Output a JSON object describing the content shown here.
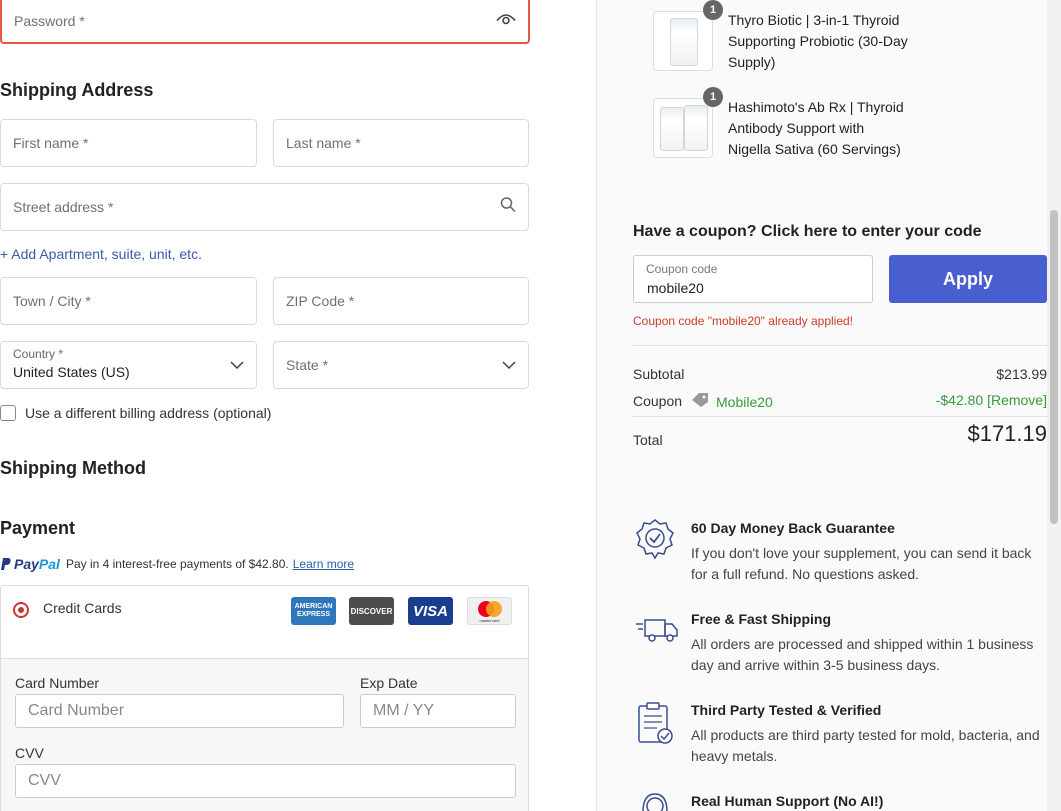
{
  "form": {
    "password_placeholder": "Password *",
    "shipping_title": "Shipping Address",
    "first_name_placeholder": "First name *",
    "last_name_placeholder": "Last name *",
    "street_placeholder": "Street address *",
    "add_apartment_link": "+ Add Apartment, suite, unit, etc.",
    "town_placeholder": "Town / City *",
    "zip_placeholder": "ZIP Code *",
    "country_label": "Country *",
    "country_value": "United States (US)",
    "state_placeholder": "State *",
    "billing_checkbox_label": "Use a different billing address (optional)",
    "shipping_method_title": "Shipping Method",
    "payment_title": "Payment"
  },
  "paypal": {
    "logo_part1": "Pay",
    "logo_part2": "Pal",
    "message": "Pay in 4 interest-free payments of $42.80.",
    "learn_more": "Learn more"
  },
  "payment": {
    "method_label": "Credit Cards",
    "card_logos": [
      "AMERICAN EXPRESS",
      "DISCOVER",
      "VISA",
      "mastercard"
    ],
    "card_number_label": "Card Number",
    "card_number_placeholder": "Card Number",
    "exp_label": "Exp Date",
    "exp_placeholder": "MM / YY",
    "cvv_label": "CVV",
    "cvv_placeholder": "CVV"
  },
  "cart": {
    "items": [
      {
        "name": "Thyro Biotic | 3-in-1 Thyroid Supporting Probiotic (30-Day Supply)",
        "qty": "1"
      },
      {
        "name": "Hashimoto's Ab Rx | Thyroid Antibody Support with Nigella Sativa (60 Servings)",
        "qty": "1"
      }
    ]
  },
  "coupon": {
    "title": "Have a coupon? Click here to enter your code",
    "field_label": "Coupon code",
    "field_value": "mobile20",
    "apply_label": "Apply",
    "error": "Coupon code \"mobile20\" already applied!"
  },
  "totals": {
    "subtotal_label": "Subtotal",
    "subtotal_value": "$213.99",
    "coupon_label": "Coupon",
    "coupon_code": "Mobile20",
    "coupon_value": "-$42.80 [Remove]",
    "total_label": "Total",
    "total_value": "$171.19"
  },
  "features": [
    {
      "icon": "badge-check-icon",
      "title": "60 Day Money Back Guarantee",
      "text": "If you don't love your supplement, you can send it back for a full refund. No questions asked."
    },
    {
      "icon": "delivery-truck-icon",
      "title": "Free & Fast Shipping",
      "text": "All orders are processed and shipped within 1 business day and arrive within 3-5 business days."
    },
    {
      "icon": "clipboard-check-icon",
      "title": "Third Party Tested & Verified",
      "text": "All products are third party tested for mold, bacteria, and heavy metals."
    },
    {
      "icon": "support-agent-icon",
      "title": "Real Human Support (No AI!)",
      "text": ""
    }
  ],
  "colors": {
    "accent": "#4a5fcf",
    "error": "#e0574a",
    "success": "#3a9a3a",
    "link": "#3a5ba8"
  }
}
